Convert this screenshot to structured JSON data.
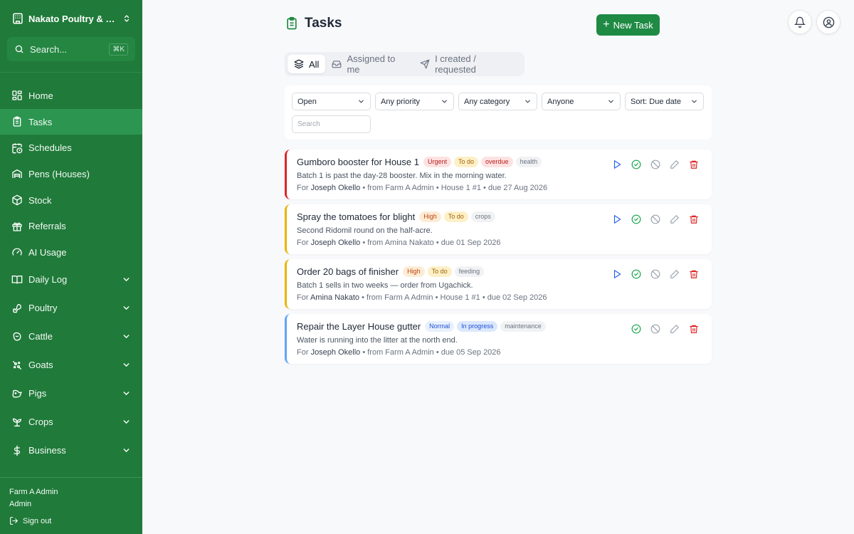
{
  "sidebar": {
    "org_name": "Nakato Poultry & Dairy",
    "search_label": "Search...",
    "search_shortcut": "⌘K",
    "items": [
      {
        "label": "Home",
        "icon": "grid-icon"
      },
      {
        "label": "Tasks",
        "icon": "clipboard-icon",
        "active": true
      },
      {
        "label": "Schedules",
        "icon": "calendar-clock-icon"
      },
      {
        "label": "Pens (Houses)",
        "icon": "warehouse-icon"
      },
      {
        "label": "Stock",
        "icon": "box-icon"
      },
      {
        "label": "Referrals",
        "icon": "gift-icon"
      },
      {
        "label": "AI Usage",
        "icon": "gauge-icon"
      }
    ],
    "groups": [
      {
        "label": "Daily Log",
        "icon": "book-icon"
      },
      {
        "label": "Poultry",
        "icon": "drumstick-icon"
      },
      {
        "label": "Cattle",
        "icon": "cattle-icon"
      },
      {
        "label": "Goats",
        "icon": "goat-icon"
      },
      {
        "label": "Pigs",
        "icon": "pig-icon"
      },
      {
        "label": "Crops",
        "icon": "sprout-icon"
      },
      {
        "label": "Business",
        "icon": "dollar-icon"
      }
    ],
    "footer": {
      "user_name": "Farm A Admin",
      "role": "Admin",
      "sign_out": "Sign out"
    }
  },
  "header": {
    "title": "Tasks",
    "new_task_label": "New Task"
  },
  "tabs": [
    {
      "label": "All",
      "active": true
    },
    {
      "label": "Assigned to me"
    },
    {
      "label": "I created / requested"
    }
  ],
  "filters": {
    "status": "Open",
    "priority": "Any priority",
    "category": "Any category",
    "assignee": "Anyone",
    "sort": "Sort: Due date",
    "search_placeholder": "Search"
  },
  "tasks": [
    {
      "title": "Gumboro booster for House 1",
      "priority": "Urgent",
      "status": "To do",
      "overdue": "overdue",
      "category": "health",
      "description": "Batch 1 is past the day-28 booster. Mix in the morning water.",
      "for_label": "For",
      "assignee": "Joseph Okello",
      "meta_rest": " • from Farm A Admin • House 1 #1 • due 27 Aug 2026",
      "accent": "#dc2626"
    },
    {
      "title": "Spray the tomatoes for blight",
      "priority": "High",
      "status": "To do",
      "category": "crops",
      "description": "Second Ridomil round on the half-acre.",
      "for_label": "For",
      "assignee": "Joseph Okello",
      "meta_rest": " • from Amina Nakato • due 01 Sep 2026",
      "accent": "#eab308"
    },
    {
      "title": "Order 20 bags of finisher",
      "priority": "High",
      "status": "To do",
      "category": "feeding",
      "description": "Batch 1 sells in two weeks — order from Ugachick.",
      "for_label": "For",
      "assignee": "Amina Nakato",
      "meta_rest": " • from Farm A Admin • House 1 #1 • due 02 Sep 2026",
      "accent": "#eab308"
    },
    {
      "title": "Repair the Layer House gutter",
      "priority": "Normal",
      "status": "In progress",
      "category": "maintenance",
      "description": "Water is running into the litter at the north end.",
      "for_label": "For",
      "assignee": "Joseph Okello",
      "meta_rest": " • from Farm A Admin • due 05 Sep 2026",
      "accent": "#60a5fa"
    }
  ],
  "colors": {
    "sidebar_bg": "#207a3a",
    "primary_button": "#1f8a44",
    "urgent": "#dc2626",
    "high": "#eab308",
    "normal": "#60a5fa"
  }
}
